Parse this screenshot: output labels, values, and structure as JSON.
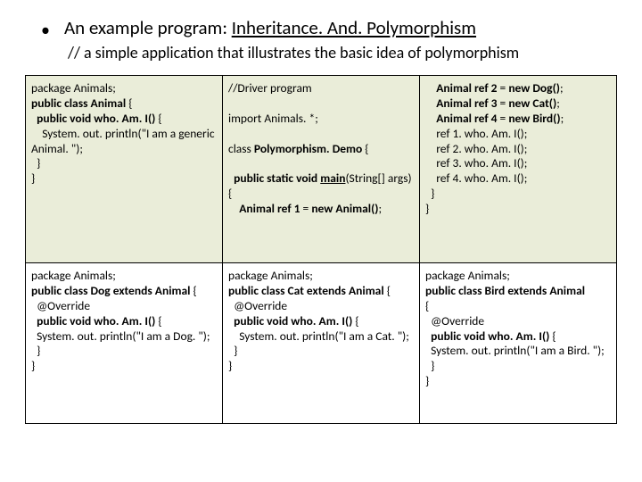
{
  "heading_prefix": "An example program: ",
  "heading_link": "Inheritance. And. Polymorphism",
  "subtitle": "// a simple application that illustrates the basic idea of polymorphism",
  "cells": {
    "r1c1": "package Animals;\npublic class Animal {\n  public void who. Am. I() {\n    System. out. println(\"I am a generic Animal. \");\n  }\n}",
    "r1c2": "//Driver program\n\nimport Animals. *;\n\nclass Polymorphism. Demo {\n\n  public static void main(String[] args) {\n    Animal ref 1 = new Animal();",
    "r1c3": "    Animal ref 2 = new Dog();\n    Animal ref 3 = new Cat();\n    Animal ref 4 = new Bird();\n    ref 1. who. Am. I();\n    ref 2. who. Am. I();\n    ref 3. who. Am. I();\n    ref 4. who. Am. I();\n  }\n}",
    "r2c1": "package Animals;\npublic class Dog extends Animal {\n  @Override\n  public void who. Am. I() {\n  System. out. println(\"I am a Dog. \");\n  }\n}",
    "r2c2": "package Animals;\npublic class Cat extends Animal {\n  @Override\n  public void who. Am. I() {\n    System. out. println(\"I am a Cat. \");\n  }\n}",
    "r2c3": "package Animals;\npublic class Bird extends Animal\n{\n  @Override\n  public void who. Am. I() {\n  System. out. println(\"I am a Bird. \");\n  }\n}"
  }
}
